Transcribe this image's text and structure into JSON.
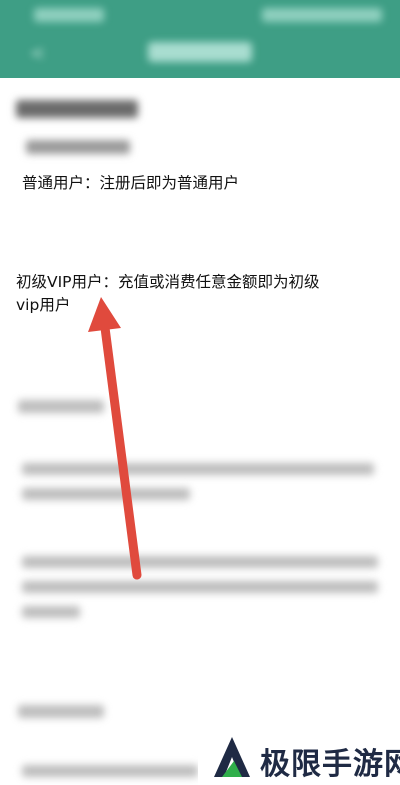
{
  "colors": {
    "app_bar": "#3e9e85",
    "arrow": "#e04a3d",
    "logo_dark": "#1f2a44",
    "logo_green": "#2fae4a"
  },
  "header": {
    "back_icon": "back-arrow-icon"
  },
  "content": {
    "line_normal": "普通用户：注册后即为普通用户",
    "line_junior_1": "初级VIP用户：充值或消费任意金额即为初级",
    "line_junior_2": "vip用户"
  },
  "watermark": {
    "brand": "极限手游网",
    "icon": "brand-logo-icon"
  }
}
